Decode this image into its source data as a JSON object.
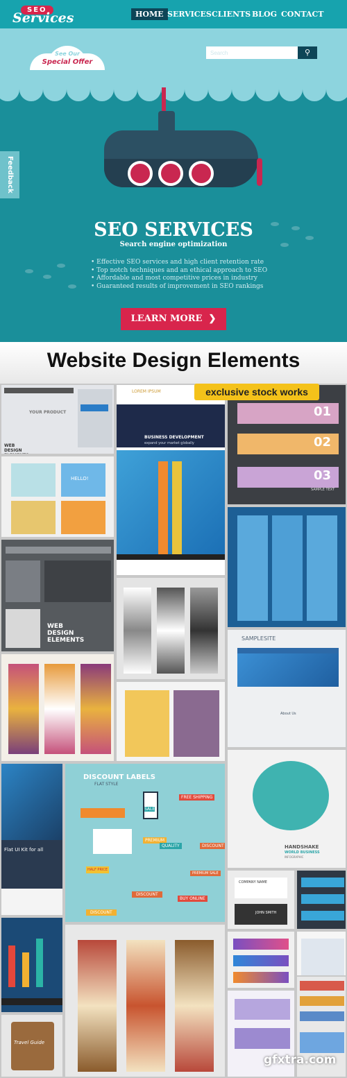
{
  "hero": {
    "logo": {
      "top": "SEO",
      "bottom": "Services"
    },
    "nav": [
      {
        "label": "HOME",
        "active": true
      },
      {
        "label": "SERVICES"
      },
      {
        "label": "CLIENTS"
      },
      {
        "label": "BLOG"
      },
      {
        "label": "CONTACT"
      }
    ],
    "offer": {
      "line1": "See Our",
      "line2": "Special Offer"
    },
    "search": {
      "placeholder": "Search",
      "icon": "search-icon"
    },
    "feedback": "Feedback",
    "title": "SEO SERVICES",
    "subtitle": "Search engine optimization",
    "bullets": [
      "Effective SEO services and high client retention rate",
      "Top notch techniques and an ethical approach to SEO",
      "Affordable and most competitive prices in industry",
      "Guaranteed results of improvement in SEO rankings"
    ],
    "cta": "LEARN MORE",
    "cta_icon": "chevron-right-icon",
    "colors": {
      "nav": "#17a3ae",
      "sky": "#8dd4de",
      "sea": "#1a8f9a",
      "accent": "#d8254c",
      "dark": "#0d4557"
    }
  },
  "collage": {
    "title": "Website Design Elements",
    "badge": "exclusive stock works",
    "tiles": {
      "ui_kit": {
        "label": "WEB DESIGN ELEMENTS",
        "product": "YOUR PRODUCT"
      },
      "hello": "HELLO!",
      "business": {
        "brand": "LOREM IPSUM",
        "heading": "BUSINESS DEVELOPMENT",
        "tagline": "expand your market globally"
      },
      "numbered": {
        "items": [
          "01",
          "02",
          "03"
        ],
        "caption": "SAMPLE TEXT"
      },
      "web_elements": "WEB DESIGN ELEMENTS",
      "samplesite": {
        "title": "SAMPLESITE",
        "section": "About Us"
      },
      "discount": {
        "title": "DISCOUNT LABELS",
        "subtitle": "FLAT STYLE",
        "labels": [
          "FREE SHIPPING",
          "SALE",
          "PREMIUM",
          "QUALITY",
          "DISCOUNT",
          "HALF PRICE",
          "PREMIUM SALE",
          "DISCOUNT",
          "BUY ONLINE",
          "DISCOUNT"
        ]
      },
      "handshake": {
        "title": "HANDSHAKE",
        "subtitle": "WORLD BUSINESS",
        "caption": "INFOGRAPHIC"
      },
      "flat_ui": "Flat UI Kit for all",
      "company": {
        "name": "COMPANY NAME",
        "person": "JOHN SMITH"
      },
      "travel": "Travel Guide",
      "watermark": "gfxtra.com"
    }
  }
}
